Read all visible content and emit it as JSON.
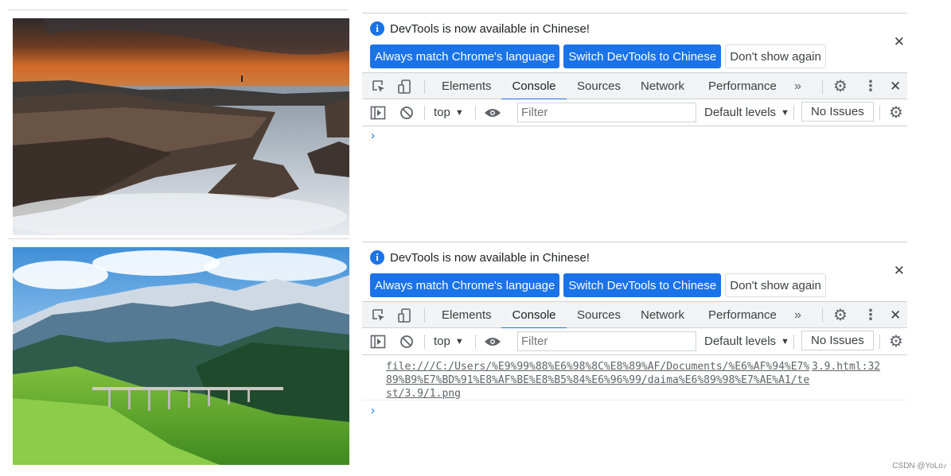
{
  "panels": [
    {
      "image_name": "coastal-rocks-photo",
      "info_text": "DevTools is now available in Chinese!",
      "buttons": [
        "Always match Chrome's language",
        "Switch DevTools to Chinese",
        "Don't show again"
      ],
      "tabs": [
        "Elements",
        "Console",
        "Sources",
        "Network",
        "Performance"
      ],
      "active_tab": "Console",
      "context": "top",
      "filter_placeholder": "Filter",
      "levels": "Default levels",
      "issues": "No Issues",
      "log": null
    },
    {
      "image_name": "mountain-bridge-photo",
      "info_text": "DevTools is now available in Chinese!",
      "buttons": [
        "Always match Chrome's language",
        "Switch DevTools to Chinese",
        "Don't show again"
      ],
      "tabs": [
        "Elements",
        "Console",
        "Sources",
        "Network",
        "Performance"
      ],
      "active_tab": "Console",
      "context": "top",
      "filter_placeholder": "Filter",
      "levels": "Default levels",
      "issues": "No Issues",
      "log": {
        "url": "file:///C:/Users/%E9%99%88%E6%98%8C%E8%89%AF/Documents/%E6%AF%94%E7%89%B9%E7%BD%91%E8%AF%BE%E8%B5%84%E6%96%99/daima%E6%89%98%E7%AE%A1/test/3.9/1.png",
        "source": "3.9.html:32"
      }
    }
  ],
  "icons": [
    "inspect-element-icon",
    "device-toolbar-icon",
    "more-tabs-icon",
    "settings-gear-icon",
    "kebab-menu-icon",
    "close-icon",
    "sidebar-toggle-icon",
    "clear-console-icon",
    "eye-icon",
    "dropdown-arrow-icon",
    "info-icon",
    "console-prompt-icon"
  ],
  "colors": {
    "accent": "#1a73e8",
    "toolbar_bg": "#f1f3f4"
  },
  "watermark": "CSDN @YoLo♪"
}
